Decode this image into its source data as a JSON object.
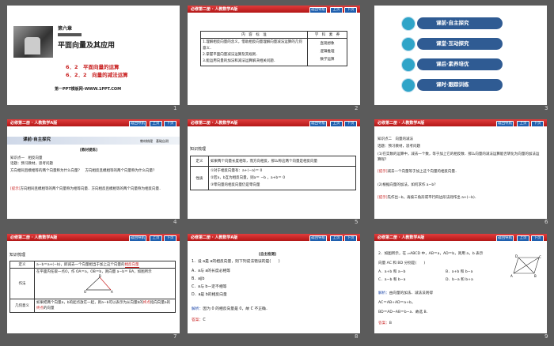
{
  "header": {
    "title": "必修第二册 · 人教数学A版",
    "back": "返回导航",
    "prev": "上页",
    "next": "下页"
  },
  "pages": [
    "1",
    "2",
    "3",
    "4",
    "5",
    "6",
    "7",
    "8",
    "9"
  ],
  "s1": {
    "chapter": "第六章",
    "chapter_title": "平面向量及其应用",
    "sec1": "6．2　平面向量的运算",
    "sec2": "6．2．2　向量的减法运算",
    "site": "第一PPT模板网-WWW.1PPT.COM"
  },
  "s2": {
    "h1": "内　容　标　准",
    "h2": "学　科　素　养",
    "std": [
      "1.理解相反向量的含义，借助相反向量理解向量减法运算的几何意义．",
      "2.掌握平面向量减法运算及其规则．",
      "3.能运用向量的加法和减法运算解决相关问题．"
    ],
    "lit": [
      "直观想象",
      "逻辑推理",
      "数学运算"
    ]
  },
  "s3": {
    "items": [
      "课前·自主探究",
      "课堂·互动探究",
      "课后·素养培优",
      "课时·跟踪训练"
    ]
  },
  "s4": {
    "band": "课前·自主探究",
    "band_r": "教材梳理　基础自测",
    "tag": "[教材提炼]",
    "l1": "知识点一　相反向量",
    "l2": "话题：预习教材，思考问题",
    "q": "方向相同且模相等的两个向量称为什么向量？　方向相反且模相等的两个向量称为什么向量？",
    "ans_label": "[提示]",
    "ans": "方向相同且模相等的两个向量称为相等向量．方向相反且模相等的两个向量称为相反向量．"
  },
  "s5": {
    "head": "知识梳理",
    "c1": "定义",
    "def": "如果两个向量长度相等，而方向相反，那么称这两个向量是相反向量",
    "k1": "相等",
    "k2": "相反",
    "c2": "性质",
    "p1": "①对于相反向量有：a+(−a)＝ 0",
    "p2": "②若a，b互为相反向量，则a＝ −b ，a+b＝ 0",
    "p3": "③零向量的相反向量仍是零向量"
  },
  "s6": {
    "l1": "知识点二　向量的减法",
    "l2": "话题：预习教材，思考问题",
    "q1": "(1)在实数的运算中，减去一个数，等于加上它的相反数．那么向量的减法运算能否转化为向量的加法运算呢？",
    "a1_label": "[提示]",
    "a1": "减去一个向量等于加上这个向量的相反向量．",
    "q2": "(2)根据向量的加法，如何求作 a−b？",
    "a2_label": "[提示]",
    "a2": "先作出−b，再按三角形或平行四边形法则作出 a+(−b)．"
  },
  "s7": {
    "head": "知识梳理",
    "r1": "定义",
    "d1": "a−b＝a+(−b)，即减去一个向量相当于加上这个向量的",
    "d1k": "相反向量",
    "r2": "作法",
    "d2": "在平面内任取一点O，作 OA＝a，OB＝b，则向量 a−b＝ BA，如图所示",
    "r3": "几何意义",
    "d3": "如果把两个向量a，b的起点放在一起，则a−b可以表示为从向量b的",
    "d3k": "终点",
    "d3b": "指向向量a的",
    "d3k2": "终点",
    "d3c": "的向量",
    "lo": "O",
    "la": "A",
    "lb": "B"
  },
  "s8": {
    "tag": "[自主检测]",
    "q": "1．设 a是 a的相反向量，则下列说法错误的是(　　)",
    "opts": [
      "A．a与 a的长度必相等",
      "B．a∥b",
      "C．a与 b一定不相等",
      "D．a是 b的相反向量"
    ],
    "sol_label": "解析：",
    "sol": "因为 0 的相反向量是 0，故 C 不正确．",
    "ans_label": "答案：",
    "ans": "C"
  },
  "s9": {
    "q": "2．如图所示，在 ▱ABCD 中，AB＝a，AD＝b，则用 a，b 表示",
    "q2": "向量 AC 和 BD 分别是(　　)",
    "opts": [
      "A．a+b 和 a−b",
      "B．a+b 和 b−a",
      "C．a−b 和 b−a",
      "D．b−a 和 b+a"
    ],
    "sol_label": "解析：",
    "sol": "由向量的加法、减法法则得",
    "s1": "AC＝AB+AD＝a+b，",
    "s2": "BD＝AD−AB＝b−a．故选 B．",
    "ans_label": "答案：",
    "ans": "B",
    "la": "A",
    "lb": "B",
    "lc": "C",
    "ld": "D"
  }
}
